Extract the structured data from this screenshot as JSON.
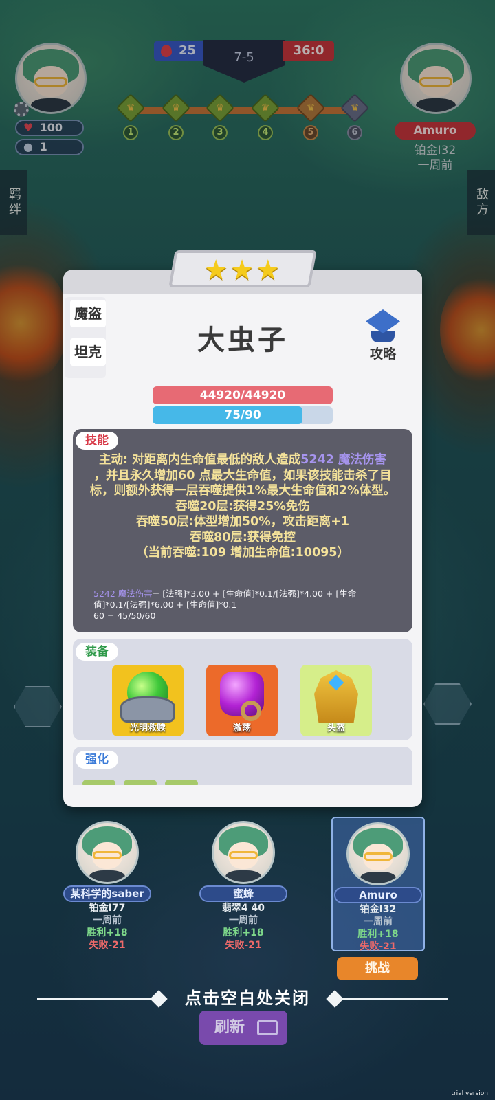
{
  "hud": {
    "player": {
      "hp": "100",
      "coins": "1"
    },
    "score": {
      "left": "25",
      "stage": "7-5",
      "right": "36:0"
    },
    "stages": [
      "1",
      "2",
      "3",
      "4",
      "5",
      "6"
    ],
    "opponent": {
      "name": "Amuro",
      "rank": "铂金Ⅰ32",
      "time": "一周前"
    },
    "left_tab": "羁绊",
    "right_tab": "敌方"
  },
  "unit": {
    "stars": "★★★",
    "name": "大虫子",
    "traits": [
      "魔盗",
      "坦克"
    ],
    "guide_label": "攻略",
    "hp_text": "44920/44920",
    "mana_text": "75/90",
    "mana_fraction": 0.8333
  },
  "skill": {
    "tag": "技能",
    "l1_a": "主动: 对距离内生命值最低的敌人造成",
    "l1_b": "5242 魔法伤害",
    "l2": "，并且永久增加60 点最大生命值，如果该技能击杀了目标，则额外获得一层吞噬提供1%最大生命值和2%体型。",
    "l3": "吞噬20层:获得25%免伤",
    "l4": "吞噬50层:体型增加50%，攻击距离+1",
    "l5": "吞噬80层:获得免控",
    "l6": "（当前吞噬:109 增加生命值:10095）",
    "formula1_a": "5242 魔法伤害",
    "formula1_b": "= [法强]*3.00 + [生命值]*0.1/[法强]*4.00 + [生命值]*0.1/[法强]*6.00 + [生命值]*0.1",
    "formula2_a": "60",
    "formula2_b": " = 45/50/60"
  },
  "equipment": {
    "tag": "装备",
    "items": [
      {
        "name": "光明救赎",
        "icon": "green-orb-icon"
      },
      {
        "name": "激荡",
        "icon": "purple-gem-icon"
      },
      {
        "name": "头盔",
        "icon": "golden-helmet-icon"
      }
    ]
  },
  "enhance": {
    "tag": "强化"
  },
  "opponents": [
    {
      "name": "某科学的saber",
      "rank": "铂金Ⅰ77",
      "time": "一周前",
      "win": "胜利+18",
      "lose": "失败-21"
    },
    {
      "name": "蜜蜂",
      "rank": "翡翠4 40",
      "time": "一周前",
      "win": "胜利+18",
      "lose": "失败-21"
    },
    {
      "name": "Amuro",
      "rank": "铂金Ⅰ32",
      "time": "一周前",
      "win": "胜利+18",
      "lose": "失败-21"
    }
  ],
  "challenge_label": "挑战",
  "close_hint": "点击空白处关闭",
  "refresh_label": "刷新",
  "watermark": "trial version",
  "colors": {
    "hp": "#e76a74",
    "mana": "#46b8e8",
    "skill_text": "#f4e29a",
    "magic_damage": "#a694ee",
    "challenge": "#e8862a"
  }
}
